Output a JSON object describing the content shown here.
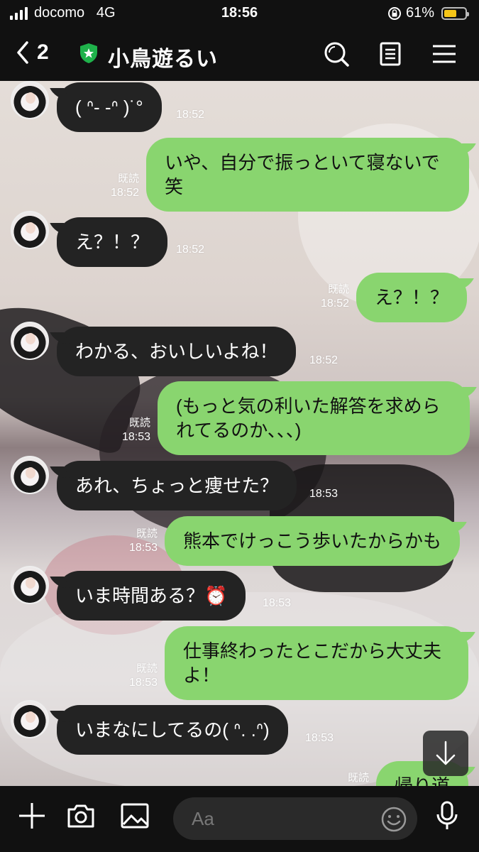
{
  "status_bar": {
    "carrier": "docomo",
    "network": "4G",
    "time": "18:56",
    "battery_pct": "61%",
    "battery_level": 0.61,
    "battery_color": "#f5c518"
  },
  "header": {
    "back_count": "2",
    "title": "小鳥遊るい"
  },
  "colors": {
    "sent_bubble": "#89d56f",
    "received_bubble": "#232323",
    "bar_bg": "#111111"
  },
  "messages": [
    {
      "side": "received",
      "text": "( ᐢ- -ᐢ )˙°",
      "time": "18:52"
    },
    {
      "side": "sent",
      "text": "いや、自分で振っといて寝ないで\n笑",
      "read": "既読",
      "time": "18:52"
    },
    {
      "side": "received",
      "text": "え？！？",
      "time": "18:52"
    },
    {
      "side": "sent",
      "text": "え？！？",
      "read": "既読",
      "time": "18:52"
    },
    {
      "side": "received",
      "text": "わかる、おいしいよね！",
      "time": "18:52"
    },
    {
      "side": "sent",
      "text": "(もっと気の利いた解答を求めら\nれてるのか、、、)",
      "read": "既読",
      "time": "18:53"
    },
    {
      "side": "received",
      "text": "あれ、ちょっと痩せた？",
      "time": "18:53"
    },
    {
      "side": "sent",
      "text": "熊本でけっこう歩いたからかも",
      "read": "既読",
      "time": "18:53"
    },
    {
      "side": "received",
      "text": "いま時間ある？⏰",
      "time": "18:53"
    },
    {
      "side": "sent",
      "text": "仕事終わったとこだから大丈夫\nよ！",
      "read": "既読",
      "time": "18:53"
    },
    {
      "side": "received",
      "text": "いまなにしてるの( ᐢ. .ᐢ)",
      "time": "18:53"
    },
    {
      "side": "sent",
      "text": "帰り道",
      "read": "既読",
      "time": ""
    }
  ],
  "input": {
    "placeholder": "Aa"
  },
  "icons": {
    "back": "chevron-left-icon",
    "verified": "shield-star-icon",
    "search": "search-icon",
    "notes": "note-icon",
    "menu": "menu-icon",
    "plus": "plus-icon",
    "camera": "camera-icon",
    "image": "image-icon",
    "emoji": "emoji-icon",
    "mic": "mic-icon",
    "scroll": "arrow-down-icon"
  }
}
